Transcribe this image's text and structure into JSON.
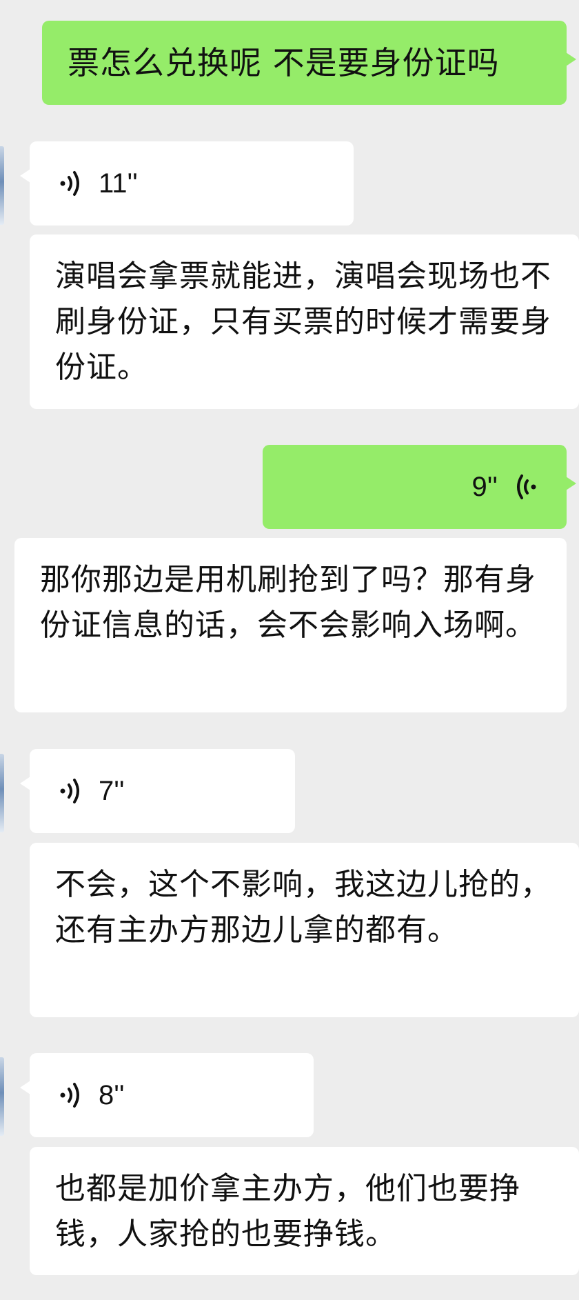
{
  "messages": [
    {
      "direction": "outgoing",
      "kind": "text",
      "text": "票怎么兑换呢 不是要身份证吗"
    },
    {
      "direction": "incoming",
      "kind": "voice",
      "duration": "11''",
      "icon": "voice-wave-icon"
    },
    {
      "direction": "incoming",
      "kind": "text",
      "text": "演唱会拿票就能进，演唱会现场也不刷身份证，只有买票的时候才需要身份证。"
    },
    {
      "direction": "outgoing",
      "kind": "voice",
      "duration": "9''",
      "icon": "voice-wave-icon"
    },
    {
      "direction": "incoming",
      "kind": "text",
      "text": "那你那边是用机刷抢到了吗？那有身份证信息的话，会不会影响入场啊。"
    },
    {
      "direction": "incoming",
      "kind": "voice",
      "duration": "7''",
      "icon": "voice-wave-icon"
    },
    {
      "direction": "incoming",
      "kind": "text",
      "text": "不会，这个不影响，我这边儿抢的，还有主办方那边儿拿的都有。"
    },
    {
      "direction": "incoming",
      "kind": "voice",
      "duration": "8''",
      "icon": "voice-wave-icon"
    },
    {
      "direction": "incoming",
      "kind": "text",
      "text": "也都是加价拿主办方，他们也要挣钱，人家抢的也要挣钱。"
    }
  ],
  "colors": {
    "background": "#ededed",
    "outgoing_bubble": "#95ec69",
    "incoming_bubble": "#ffffff",
    "text": "#111111"
  }
}
